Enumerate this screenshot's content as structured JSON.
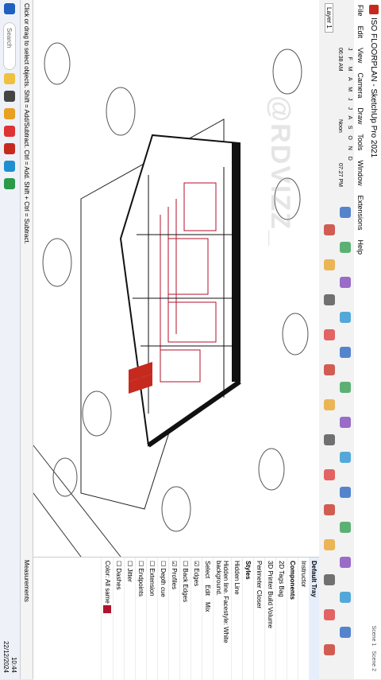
{
  "window": {
    "title": "ISO FLOORPLAN - SketchUp Pro 2021",
    "scene_tabs": [
      "Scene 1",
      "Scene 2"
    ]
  },
  "menu": [
    "File",
    "Edit",
    "View",
    "Camera",
    "Draw",
    "Tools",
    "Window",
    "Extensions",
    "Help"
  ],
  "shadow_bar": {
    "months": "J F M A M J J A S O N D",
    "time_start": "06:38 AM",
    "time_mid": "Noon",
    "time_end": "07:27 PM"
  },
  "layer_selector": "Layer 1",
  "watermark": "@RDVIZZ_",
  "status": {
    "hint": "Click or drag to select objects. Shift = Add/Subtract. Ctrl = Add. Shift + Ctrl = Subtract.",
    "measurements_label": "Measurements"
  },
  "tray": {
    "title": "Default Tray",
    "instructor": "Instructor",
    "panels": [
      "Styles",
      "Components"
    ],
    "styles_tabs": [
      "Select",
      "Edit",
      "Mix"
    ],
    "edge_options": [
      "Edges",
      "Back Edges",
      "Profiles",
      "Depth cue",
      "Extension",
      "Endpoints",
      "Jitter",
      "Dashes"
    ],
    "color_label": "Color:",
    "color_value": "All same",
    "style_name": "Hidden Line",
    "style_desc": "Hidden line. Facestyle: White background.",
    "component_items": [
      "2D Tags Bag",
      "3D Printer Build Volume",
      "Perimeter Closer"
    ],
    "accent": "#1f5fbf"
  },
  "taskbar": {
    "search_placeholder": "Search",
    "time": "10:44",
    "date": "22/12/2024"
  },
  "colors": {
    "building_outline": "#111111",
    "building_detail": "#b3122b",
    "accent_red": "#c62a1e"
  }
}
